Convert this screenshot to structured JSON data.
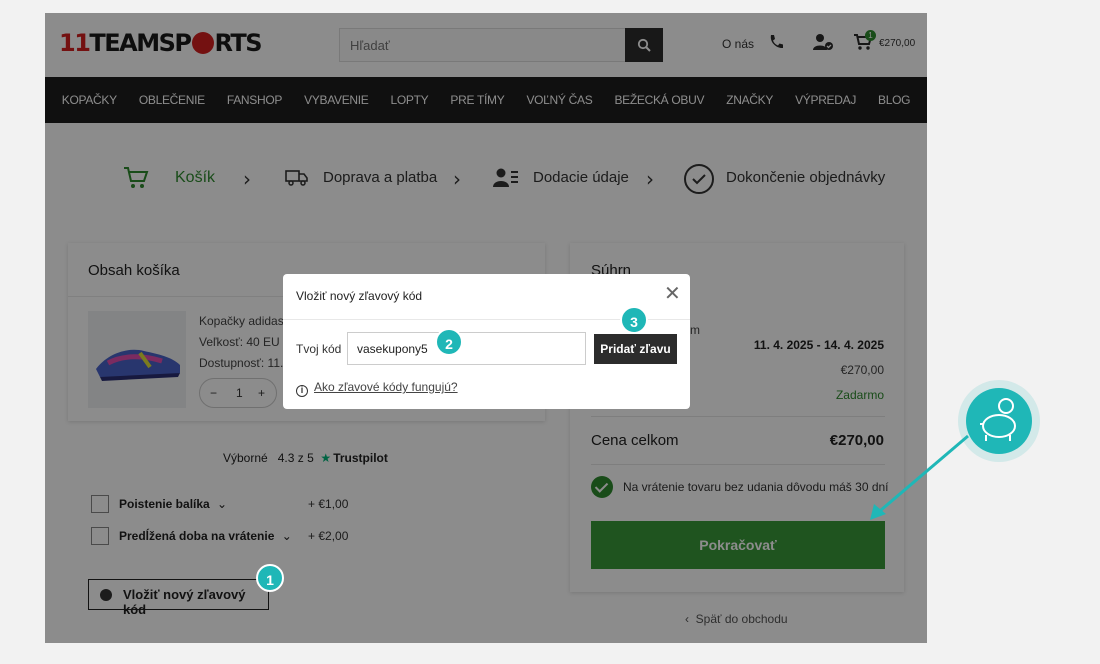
{
  "header": {
    "logo_text": "11TEAMSPORTS",
    "search_placeholder": "Hľadať",
    "about_link": "O nás",
    "cart_count": "1",
    "cart_total": "€270,00"
  },
  "nav": [
    "KOPAČKY",
    "OBLEČENIE",
    "FANSHOP",
    "VYBAVENIE",
    "LOPTY",
    "PRE TÍMY",
    "VOĽNÝ ČAS",
    "BEŽECKÁ OBUV",
    "ZNAČKY",
    "VÝPREDAJ",
    "BLOG"
  ],
  "steps": [
    {
      "label": "Košík"
    },
    {
      "label": "Doprava a platba"
    },
    {
      "label": "Dodacie údaje"
    },
    {
      "label": "Dokončenie objednávky"
    }
  ],
  "cart": {
    "title": "Obsah košíka",
    "product_name": "Kopačky adidas",
    "product_size": "Veľkosť: 40 EU | (",
    "product_availability": "Dostupnosť: 11.",
    "qty": "1",
    "qty_minus": "−",
    "qty_plus": "+"
  },
  "trust": {
    "rating_word": "Výborné",
    "score": "4.3 z 5",
    "brand": "Trustpilot"
  },
  "options": [
    {
      "label": "Poistenie balíka",
      "price": "+ €1,00"
    },
    {
      "label": "Predĺžená doba na vrátenie",
      "price": "+ €2,00"
    }
  ],
  "coupon_button": "Vložiť nový zľavový kód",
  "summary": {
    "title": "Súhrn",
    "fragment": "m",
    "delivery_dates": "11. 4. 2025 - 14. 4. 2025",
    "subtotal": "€270,00",
    "shipping": "Zadarmo",
    "total_label": "Cena celkom",
    "total_value": "€270,00",
    "return_note": "Na vrátenie tovaru bez udania dôvodu máš 30 dní",
    "continue_button": "Pokračovať",
    "back_link": "Späť do obchodu"
  },
  "modal": {
    "title": "Vložiť nový zľavový kód",
    "code_label": "Tvoj kód",
    "code_value": "vasekupony5",
    "apply_button": "Pridať zľavu",
    "help_link": "Ako zľavové kódy fungujú?"
  },
  "markers": [
    "1",
    "2",
    "3"
  ],
  "colors": {
    "brand_green": "#3a9a3a",
    "accent_teal": "#1fb7b7",
    "brand_red": "#d42020"
  }
}
